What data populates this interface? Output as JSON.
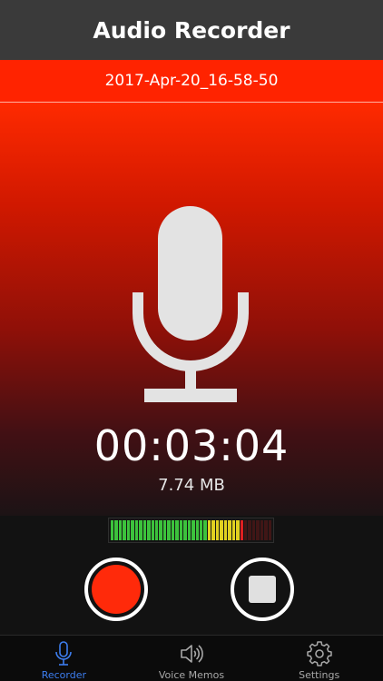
{
  "app": {
    "title": "Audio Recorder"
  },
  "recording": {
    "filename": "2017-Apr-20_16-58-50",
    "elapsed": "00:03:04",
    "file_size": "7.74 MB",
    "level_fraction": 0.83
  },
  "tabs": [
    {
      "label": "Recorder",
      "icon": "microphone-icon",
      "active": true
    },
    {
      "label": "Voice Memos",
      "icon": "speaker-icon",
      "active": false
    },
    {
      "label": "Settings",
      "icon": "gear-icon",
      "active": false
    }
  ],
  "colors": {
    "accent_red": "#ff2300",
    "tab_active": "#3d7ef0",
    "meter_green": "#3cc23c",
    "meter_yellow": "#e0d020",
    "meter_red": "#e02020"
  }
}
